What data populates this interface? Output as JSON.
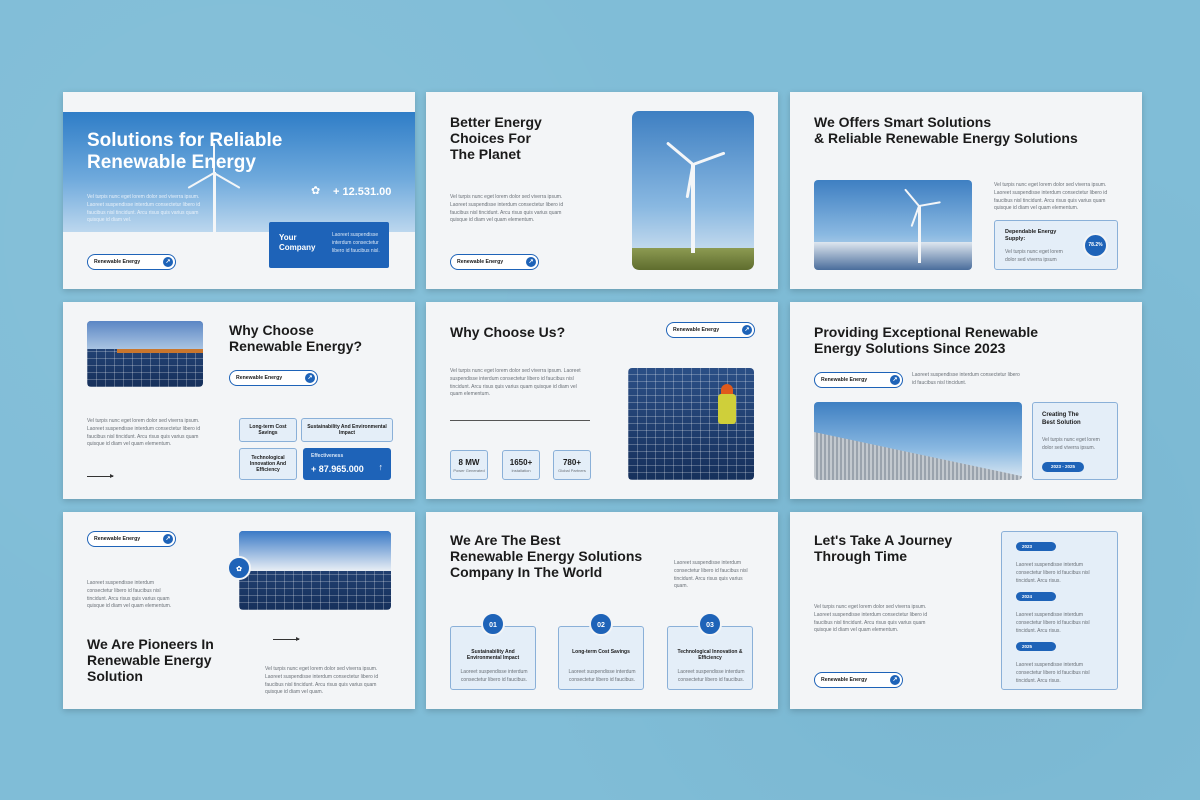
{
  "brand_pill": "Renewable Energy",
  "lorem_short": "Vel turpis nunc eget lorem dolor sed viverra ipsum. Laoreet suspendisse interdum consectetur libero id faucibus nisl tincidunt. Arcu risus quis varius quam quisque id diam vel quam elementum.",
  "lorem_med": "Vel turpis nunc eget lorem dolor sed viverra ipsum. Laoreet suspendisse interdum consectetur libero id faucibus nisl tincidunt. Arcu risus quis varius quam quisque id diam vel quam.",
  "lorem_lg": "Laoreet suspendisse interdum consectetur libero id faucibus nisl tincidunt. Arcu risus quis varius quam quisque id diam vel quam.",
  "slide1": {
    "title_line1": "Solutions for Reliable",
    "title_line2": "Renewable Energy",
    "stat": "+ 12.531.00",
    "body": "Vel turpis nunc eget lorem dolor sed viverra ipsum. Laoreet suspendisse interdum consectetur libero id faucibus nisl tincidunt. Arcu risus quis varius quam quisque id diam vel.",
    "card_title_1": "Your",
    "card_title_2": "Company",
    "card_body": "Laoreet suspendisse interdum consectetur libero id faucibus nisl."
  },
  "slide2": {
    "title_line1": "Better Energy",
    "title_line2": "Choices For",
    "title_line3": "The Planet",
    "body": "Vel turpis nunc eget lorem dolor sed viverra ipsum. Laoreet suspendisse interdum consectetur libero id faucibus nisl tincidunt. Arcu risus quis varius quam quisque id diam vel quam elementum."
  },
  "slide3": {
    "title_line1": "We Offers Smart Solutions",
    "title_line2": "& Reliable Renewable Energy Solutions",
    "body": "Vel turpis nunc eget lorem dolor sed viverra ipsum. Laoreet suspendisse interdum consectetur libero id faucibus nisl tincidunt. Arcu risus quis varius quam quisque id diam vel quam elementum.",
    "card_title_1": "Dependable Energy",
    "card_title_2": "Supply:",
    "card_body": "Vel turpis nunc eget lorem dolor sed viverra ipsum",
    "percent": "78.2%"
  },
  "slide4": {
    "title_line1": "Why Choose",
    "title_line2": "Renewable Energy?",
    "body": "Vel turpis nunc eget lorem dolor sed viverra ipsum. Laoreet suspendisse interdum consectetur libero id faucibus nisl tincidunt. Arcu risus quis varius quam quisque id diam vel quam elementum.",
    "box1": "Long-term Cost Savings",
    "box2": "Sustainability And Environmental Impact",
    "box3": "Technological Innovation And Efficiency",
    "eff_label": "Effectiveness",
    "eff_value": "+ 87.965.000"
  },
  "slide5": {
    "title": "Why Choose Us?",
    "body": "Vel turpis nunc eget lorem dolor sed viverra ipsum. Laoreet suspendisse interdum consectetur libero id faucibus nisl tincidunt. Arcu risus quis varius quam quisque id diam vel quam elementum.",
    "stats": [
      {
        "value": "8 MW",
        "label": "Power Generated"
      },
      {
        "value": "1650+",
        "label": "Installation"
      },
      {
        "value": "780+",
        "label": "Global Partners"
      }
    ]
  },
  "slide6": {
    "title_line1": "Providing Exceptional Renewable",
    "title_line2": "Energy Solutions Since 2023",
    "body": "Laoreet suspendisse interdum consectetur libero id faucibus nisl tincidunt.",
    "card_title_1": "Creating The",
    "card_title_2": "Best Solution",
    "card_body": "Vel turpis nunc eget lorem dolor sed viverra ipsum.",
    "years": "2023 - 2025"
  },
  "slide7": {
    "title_line1": "We Are Pioneers In",
    "title_line2": "Renewable Energy",
    "title_line3": "Solution",
    "body_top": "Laoreet suspendisse interdum consectetur libero id faucibus nisl tincidunt. Arcu risus quis varius quam quisque id diam vel quam elementum.",
    "body_bottom": "Vel turpis nunc eget lorem dolor sed viverra ipsum. Laoreet suspendisse interdum consectetur libero id faucibus nisl tincidunt. Arcu risus quis varius quam quisque id diam vel quam."
  },
  "slide8": {
    "title_line1": "We Are The Best",
    "title_line2": "Renewable Energy Solutions",
    "title_line3": "Company In The World",
    "body": "Laoreet suspendisse interdum consectetur libero id faucibus nisl tincidunt. Arcu risus quis varius quam.",
    "items": [
      {
        "num": "01",
        "title": "Sustainability And Environmental Impact",
        "body": "Laoreet suspendisse interdum consectetur libero id faucibus."
      },
      {
        "num": "02",
        "title": "Long-term Cost Savings",
        "body": "Laoreet suspendisse interdum consectetur libero id faucibus."
      },
      {
        "num": "03",
        "title": "Technological Innovation & Efficiency",
        "body": "Laoreet suspendisse interdum consectetur libero id faucibus."
      }
    ]
  },
  "slide9": {
    "title_line1": "Let's Take A Journey",
    "title_line2": "Through Time",
    "body": "Vel turpis nunc eget lorem dolor sed viverra ipsum. Laoreet suspendisse interdum consectetur libero id faucibus nisl tincidunt. Arcu risus quis varius quam quisque id diam vel quam elementum.",
    "timeline": [
      {
        "year": "2023",
        "body": "Laoreet suspendisse interdum consectetur libero id faucibus nisl tincidunt. Arcu risus."
      },
      {
        "year": "2024",
        "body": "Laoreet suspendisse interdum consectetur libero id faucibus nisl tincidunt. Arcu risus."
      },
      {
        "year": "2025",
        "body": "Laoreet suspendisse interdum consectetur libero id faucibus nisl tincidunt. Arcu risus."
      }
    ]
  },
  "colors": {
    "accent": "#1e63b8",
    "background": "#80bdd7",
    "slide": "#f3f5f7"
  }
}
